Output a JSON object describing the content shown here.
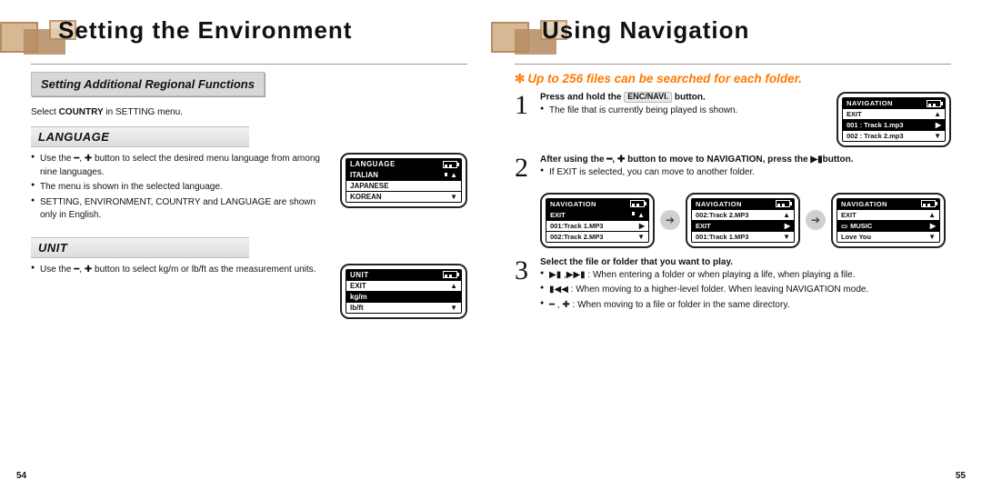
{
  "left": {
    "title": "Setting the Environment",
    "region_banner": "Setting Additional Regional Functions",
    "select_note_pre": "Select ",
    "select_note_bold": "COUNTRY",
    "select_note_post": " in SETTING menu.",
    "language": {
      "heading": "LANGUAGE",
      "b1_pre": "Use the ",
      "b1_mid": " button to select the desired menu language  from among nine languages.",
      "b2": "The menu is shown in the selected language.",
      "b3": "SETTING, ENVIRONMENT, COUNTRY and LANGUAGE are shown only in English.",
      "lcd": {
        "head": "LANGUAGE",
        "r1": "ITALIAN",
        "r2": "JAPANESE",
        "r3": "KOREAN"
      }
    },
    "unit": {
      "heading": "UNIT",
      "b1_pre": "Use the ",
      "b1_mid": " button to select kg/m or lb/ft as the measurement units.",
      "lcd": {
        "head": "UNIT",
        "r1": "EXIT",
        "r2": "kg/m",
        "r3": "lb/ft"
      }
    },
    "page_num": "54"
  },
  "right": {
    "title": "Using Navigation",
    "callout": "Up to 256 files can be searched for each folder.",
    "step1": {
      "lead_pre": "Press and hold the ",
      "lead_btn": "ENC/NAVI.",
      "lead_post": " button.",
      "b1": "The file that is currently being played is shown.",
      "lcd": {
        "head": "NAVIGATION",
        "r1": "EXIT",
        "r2": "001 : Track 1.mp3",
        "r3": "002 : Track 2.mp3"
      }
    },
    "step2": {
      "lead_pre": "After using the ",
      "lead_mid": " button to move to NAVIGATION, press the ",
      "lead_post": "button.",
      "b1": "If EXIT is selected, you can move to another folder.",
      "lcd_a": {
        "head": "NAVIGATION",
        "r1": "EXIT",
        "r2": "001:Track 1.MP3",
        "r3": "002:Track 2.MP3"
      },
      "lcd_b": {
        "head": "NAVIGATION",
        "r1": "002:Track 2.MP3",
        "r2": "EXIT",
        "r3": "001:Track 1.MP3"
      },
      "lcd_c": {
        "head": "NAVIGATION",
        "r1": "EXIT",
        "r2": "MUSIC",
        "r3": "Love You"
      }
    },
    "step3": {
      "lead": "Select the file or folder that you want to play.",
      "b1": " : When entering a folder or when playing a life, when playing a file.",
      "b2": " : When moving to a higher-level folder. When leaving NAVIGATION mode.",
      "b3": " : When moving to a file or folder in the same directory."
    },
    "page_num": "55"
  }
}
